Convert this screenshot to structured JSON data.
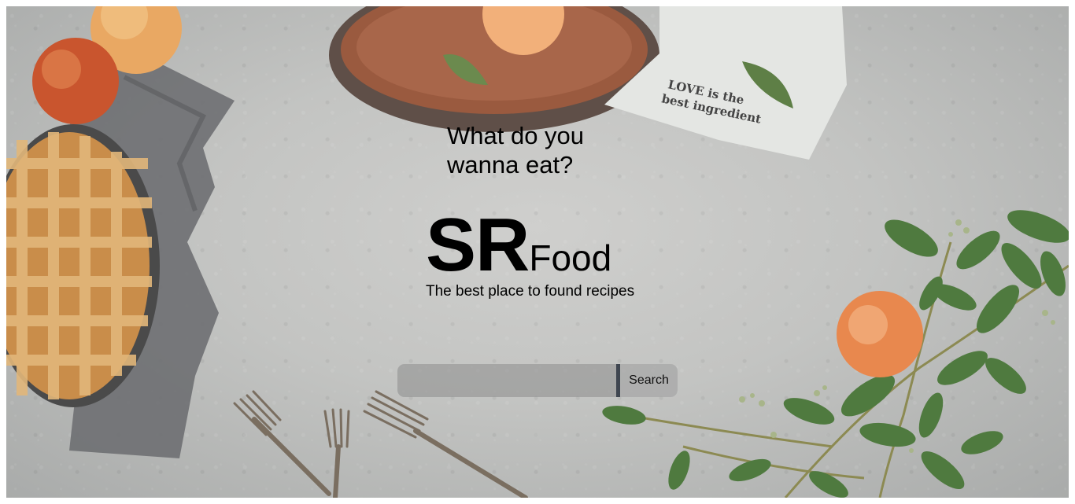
{
  "hero": {
    "heading": "What do you wanna eat?",
    "napkin_text_line1": "LOVE is the",
    "napkin_text_line2": "best ingredient"
  },
  "logo": {
    "primary": "SR",
    "secondary": "Food"
  },
  "tagline": "The best place to found recipes",
  "search": {
    "placeholder": "",
    "value": "",
    "button_label": "Search"
  }
}
